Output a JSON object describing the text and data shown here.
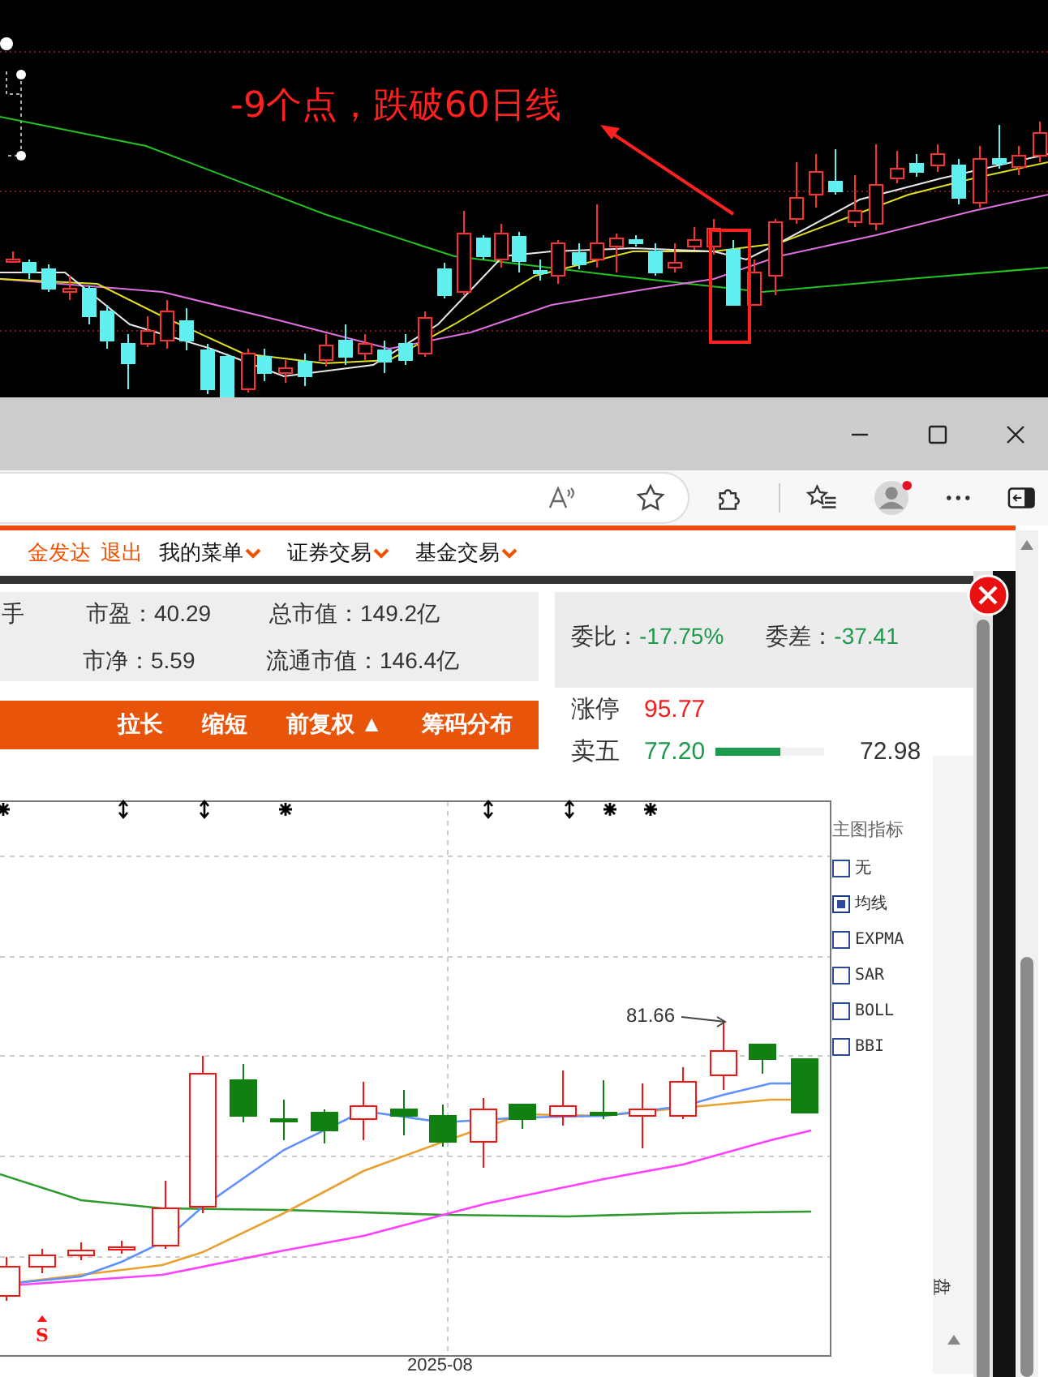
{
  "background_chart": {
    "annotation": "-9个点，跌破60日线"
  },
  "nav": {
    "items": [
      {
        "label": "金发达",
        "kind": "user"
      },
      {
        "label": "退出",
        "kind": "logout"
      },
      {
        "label": "我的菜单",
        "kind": "menu"
      },
      {
        "label": "证券交易",
        "kind": "menu"
      },
      {
        "label": "基金交易",
        "kind": "menu"
      }
    ]
  },
  "quote": {
    "fields": [
      [
        "手",
        "市盈：40.29",
        "总市值：149.2亿"
      ],
      [
        "市净：5.59",
        "流通市值：146.4亿"
      ]
    ]
  },
  "order_book": {
    "stats": [
      {
        "label": "委比：",
        "value": "-17.75%",
        "color": "#1a9a4a"
      },
      {
        "label": "委差：",
        "value": "-37.41",
        "color": "#1a9a4a"
      }
    ],
    "rows": [
      {
        "label": "涨停",
        "price": "95.77",
        "color": "#f02020"
      },
      {
        "label": "卖五",
        "price": "77.20",
        "color": "#1a9a4a",
        "level": 0.6,
        "volume": "72.98"
      }
    ]
  },
  "chart_toolbar": {
    "buttons": [
      {
        "label": "拉长"
      },
      {
        "label": "缩短"
      },
      {
        "label": "前复权 ▲"
      },
      {
        "label": "筹码分布"
      }
    ]
  },
  "kline": {
    "price_label": "81.66",
    "signal": "S",
    "xlabel": "2025-08",
    "indicator_panel": {
      "title": "主图指标",
      "options": [
        {
          "label": "无",
          "selected": false
        },
        {
          "label": "均线",
          "selected": true
        },
        {
          "label": "EXPMA",
          "selected": false
        },
        {
          "label": "SAR",
          "selected": false
        },
        {
          "label": "BOLL",
          "selected": false
        },
        {
          "label": "BBI",
          "selected": false
        }
      ]
    },
    "side_text": "盘"
  }
}
